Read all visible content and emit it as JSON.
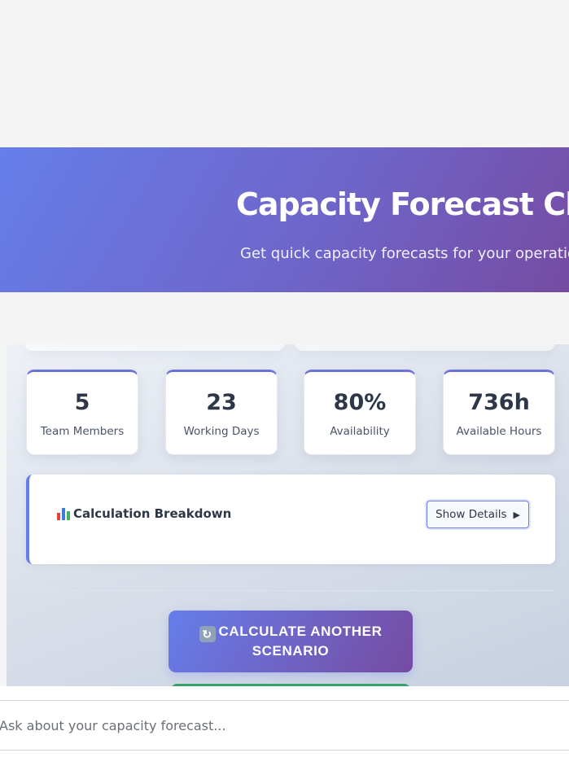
{
  "hero": {
    "title": "Capacity Forecast Chatbot",
    "subtitle": "Get quick capacity forecasts for your operations team"
  },
  "stats": [
    {
      "value": "5",
      "label": "Team Members"
    },
    {
      "value": "23",
      "label": "Working Days"
    },
    {
      "value": "80%",
      "label": "Availability"
    },
    {
      "value": "736h",
      "label": "Available Hours"
    }
  ],
  "breakdown": {
    "title": "Calculation Breakdown",
    "icon": "bar-chart-icon",
    "toggle_label": "Show Details",
    "toggle_icon": "play-triangle-icon"
  },
  "actions": {
    "calculate_label": "CALCULATE ANOTHER SCENARIO",
    "calculate_icon": "refresh-icon"
  },
  "input": {
    "placeholder": "Ask about your capacity forecast..."
  },
  "colors": {
    "accent_start": "#667eea",
    "accent_end": "#764ba2",
    "success": "#38a169"
  }
}
